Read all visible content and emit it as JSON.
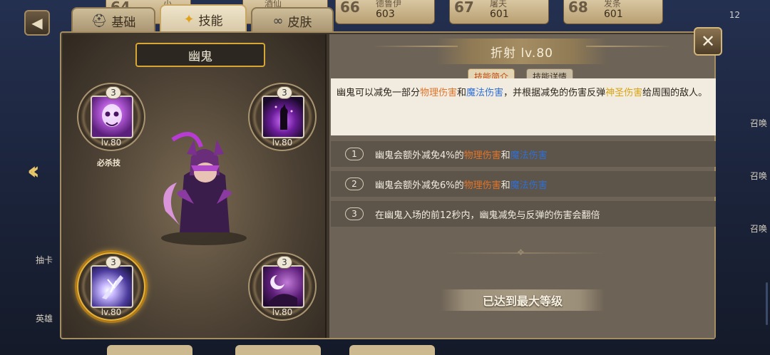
{
  "background": {
    "top_cards": [
      {
        "num": "64",
        "name": "小…",
        "power": ""
      },
      {
        "num": "",
        "name": "酒仙",
        "power": ""
      },
      {
        "num": "66",
        "name": "德鲁伊",
        "power": "603"
      },
      {
        "num": "67",
        "name": "屠夫",
        "power": "601"
      },
      {
        "num": "68",
        "name": "发条",
        "power": "601"
      }
    ],
    "corner_number": "12",
    "left_side_labels": [
      "抽卡",
      "英雄"
    ],
    "right_side_labels": [
      "召唤",
      "召唤",
      "召唤"
    ]
  },
  "tabs": [
    {
      "label": "基础",
      "icon": "helmet-icon"
    },
    {
      "label": "技能",
      "icon": "skill-star-icon"
    },
    {
      "label": "皮肤",
      "icon": "skin-rings-icon"
    }
  ],
  "hero": {
    "name": "幽鬼"
  },
  "skills": [
    {
      "level_badge": "3",
      "level": "lv.80",
      "tag": "必杀技"
    },
    {
      "level_badge": "3",
      "level": "lv.80"
    },
    {
      "level_badge": "3",
      "level": "lv.80"
    },
    {
      "level_badge": "3",
      "level": "lv.80"
    }
  ],
  "detail": {
    "title": "折射  lv.80",
    "subtabs": [
      "技能简介",
      "技能详情"
    ],
    "desc": {
      "p1": "幽鬼可以减免一部分",
      "phys": "物理伤害",
      "and": "和",
      "magic": "魔法伤害",
      "p2": "，并根据减免的伤害反弹",
      "holy": "神圣伤害",
      "p3": "给周围的敌人。"
    },
    "effects": [
      {
        "num": "1",
        "text_a": "幽鬼会额外减免4%的",
        "phys": "物理伤害",
        "and": "和",
        "magic": "魔法伤害"
      },
      {
        "num": "2",
        "text_a": "幽鬼会额外减免6%的",
        "phys": "物理伤害",
        "and": "和",
        "magic": "魔法伤害"
      },
      {
        "num": "3",
        "text_a": "在幽鬼入场的前12秒内，幽鬼减免与反弹的伤害会翻倍"
      }
    ],
    "max_level_text": "已达到最大等级"
  },
  "colors": {
    "physical": "#e2752a",
    "magic": "#2f6fd6",
    "holy": "#d8a414",
    "gold_accent": "#e7b23a"
  }
}
